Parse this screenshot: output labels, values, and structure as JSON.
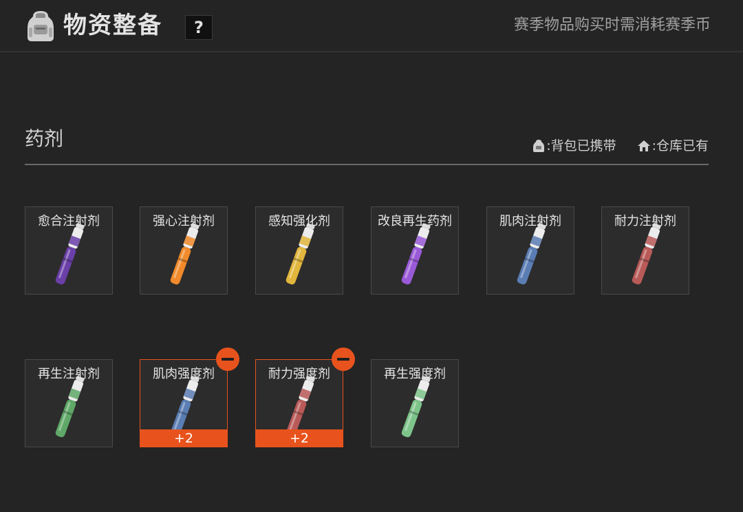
{
  "header": {
    "title": "物资整备",
    "help_label": "?",
    "season_note": "赛季物品购买时需消耗赛季币"
  },
  "section": {
    "title": "药剂",
    "legend_backpack": ":背包已携带",
    "legend_warehouse": ":仓库已有"
  },
  "items": [
    {
      "name": "愈合注射剂",
      "color": "#6a3fa8"
    },
    {
      "name": "强心注射剂",
      "color": "#f08a2a"
    },
    {
      "name": "感知强化剂",
      "color": "#e2b63c"
    },
    {
      "name": "改良再生药剂",
      "color": "#9a5ad8"
    },
    {
      "name": "肌肉注射剂",
      "color": "#5a7db4"
    },
    {
      "name": "耐力注射剂",
      "color": "#b85a58"
    },
    {
      "name": "再生注射剂",
      "color": "#5fa868"
    },
    {
      "name": "肌肉强度剂",
      "color": "#5a7db4",
      "count": "+2"
    },
    {
      "name": "耐力强度剂",
      "color": "#b85a58",
      "count": "+2"
    },
    {
      "name": "再生强度剂",
      "color": "#7ec48a"
    }
  ]
}
